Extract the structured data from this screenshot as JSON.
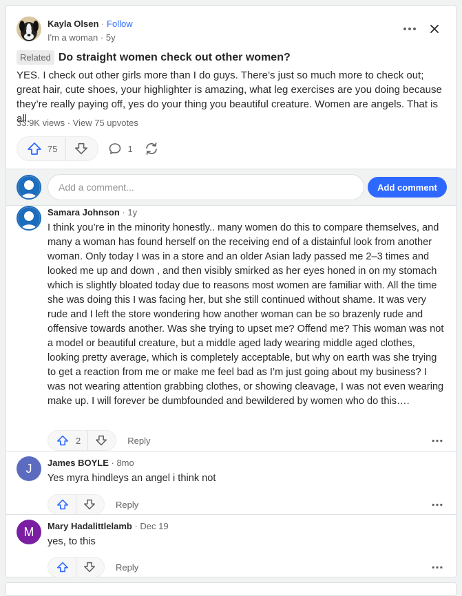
{
  "post": {
    "author": {
      "name": "Kayla Olsen",
      "follow_label": "Follow",
      "credential": "I'm a woman",
      "age": "5y"
    },
    "related_label": "Related",
    "question": "Do straight women check out other women?",
    "answer": "YES. I check out other girls more than I do guys. There’s just so much more to check out; great hair, cute shoes, your highlighter is amazing, what leg exercises are you doing because they’re really paying off, yes do your thing you beautiful creature. Women are angels. That is all.",
    "views": "33.9K views",
    "upvotes_link": "View 75 upvotes",
    "upvote_count": "75",
    "comment_count": "1"
  },
  "comment_box": {
    "placeholder": "Add a comment...",
    "button_label": "Add comment"
  },
  "comments": [
    {
      "name": "Samara Johnson",
      "time": "1y",
      "body": "I think you’re in the minority honestly.. many women do this to compare themselves, and many a woman has found herself on the receiving end of a distainful look from another woman. Only today I was in a store and an older Asian lady passed me 2–3 times and looked me up and down , and then visibly smirked as her eyes honed in on my stomach which is slightly bloated today due to reasons most women are familiar with. All the time she was doing this I was facing her, but she still continued without shame. It was very rude and I left the store wondering how another woman can be so brazenly rude and offensive towards another. Was she trying to upset me? Offend me? This woman was not a model or beautiful creature, but a middle aged lady wearing middle aged clothes, looking pretty average, which is completely acceptable, but why on earth was she trying to get a reaction from me or make me feel bad as I’m just going about my business? I was not wearing attention grabbing clothes, or showing cleavage, I was not even wearing make up. I will forever be dumbfounded and bewildered by women who do this….",
      "upvotes": "2",
      "reply_label": "Reply"
    },
    {
      "name": "James BOYLE",
      "initial": "J",
      "time": "8mo",
      "body": "Yes myra hindleys an angel i think not",
      "reply_label": "Reply",
      "avatar_color": "#5b6bbf"
    },
    {
      "name": "Mary Hadalittlelamb",
      "initial": "M",
      "time": "Dec 19",
      "body": "yes, to this",
      "reply_label": "Reply",
      "avatar_color": "#7b1fa2"
    }
  ],
  "colors": {
    "accent": "#2e69ff",
    "avatar_border": "#1d6dbd"
  }
}
